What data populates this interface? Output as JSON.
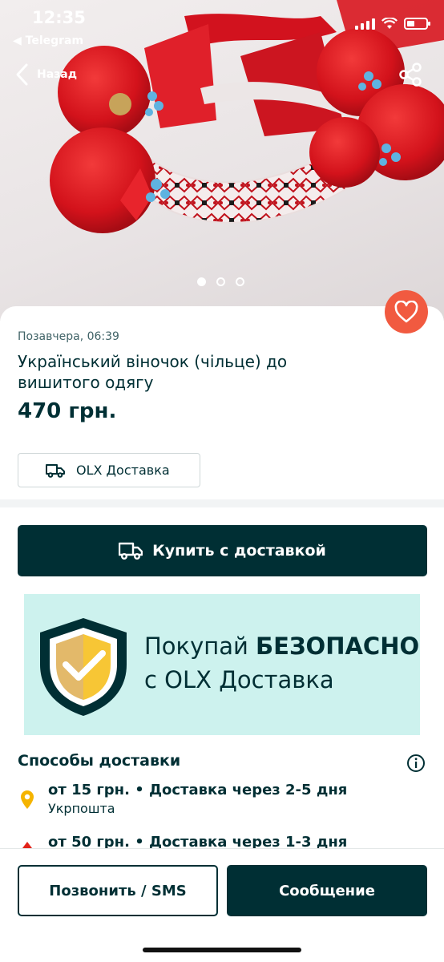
{
  "status_bar": {
    "time": "12:35",
    "back_app": "◀ Telegram"
  },
  "nav": {
    "back_label": "Назад"
  },
  "gallery": {
    "image_count": 3,
    "active_index": 0
  },
  "listing": {
    "posted": "Позавчера, 06:39",
    "title": "Український віночок (чільце) до вишитого одягу",
    "price": "470 грн.",
    "delivery_badge": "OLX Доставка"
  },
  "buy_button": {
    "label": "Купить с доставкой"
  },
  "banner": {
    "line1_prefix": "Покупай ",
    "line1_bold": "БЕЗОПАСНО",
    "line2": "с OLX Доставка"
  },
  "shipping": {
    "title": "Способы доставки",
    "options": [
      {
        "main": "от 15 грн. • Доставка через 2-5 дня",
        "sub": "Укрпошта"
      },
      {
        "main": "от 50 грн. • Доставка через 1-3 дня",
        "sub": ""
      }
    ]
  },
  "actions": {
    "call_label": "Позвонить / SMS",
    "message_label": "Сообщение"
  },
  "colors": {
    "brand_dark": "#002f34",
    "favorite": "#f15a40",
    "banner_bg": "#cdf2ee",
    "pin": "#f5b400"
  }
}
